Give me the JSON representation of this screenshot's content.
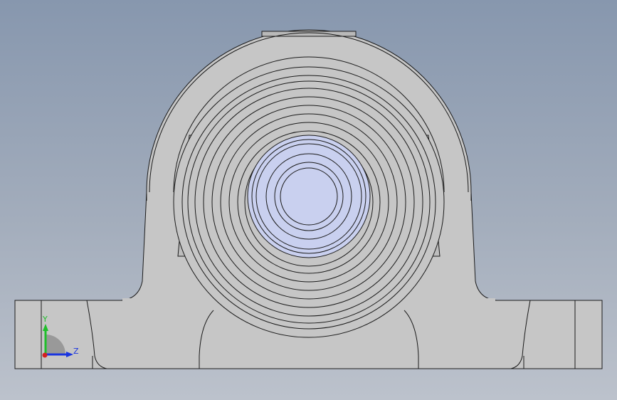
{
  "viewport": {
    "background_top": "#8797ae",
    "background_bottom": "#bcc2cc"
  },
  "model": {
    "name": "pillow-block-bearing",
    "view": "front",
    "housing_color": "#c6c6c6",
    "bore_color": "#c9d0ef",
    "edge_color": "#1a1a1a"
  },
  "triad": {
    "y_label": "Y",
    "z_label": "Z",
    "y_color": "#1fbf2a",
    "z_color": "#1a35e0",
    "x_color": "#d42020"
  }
}
